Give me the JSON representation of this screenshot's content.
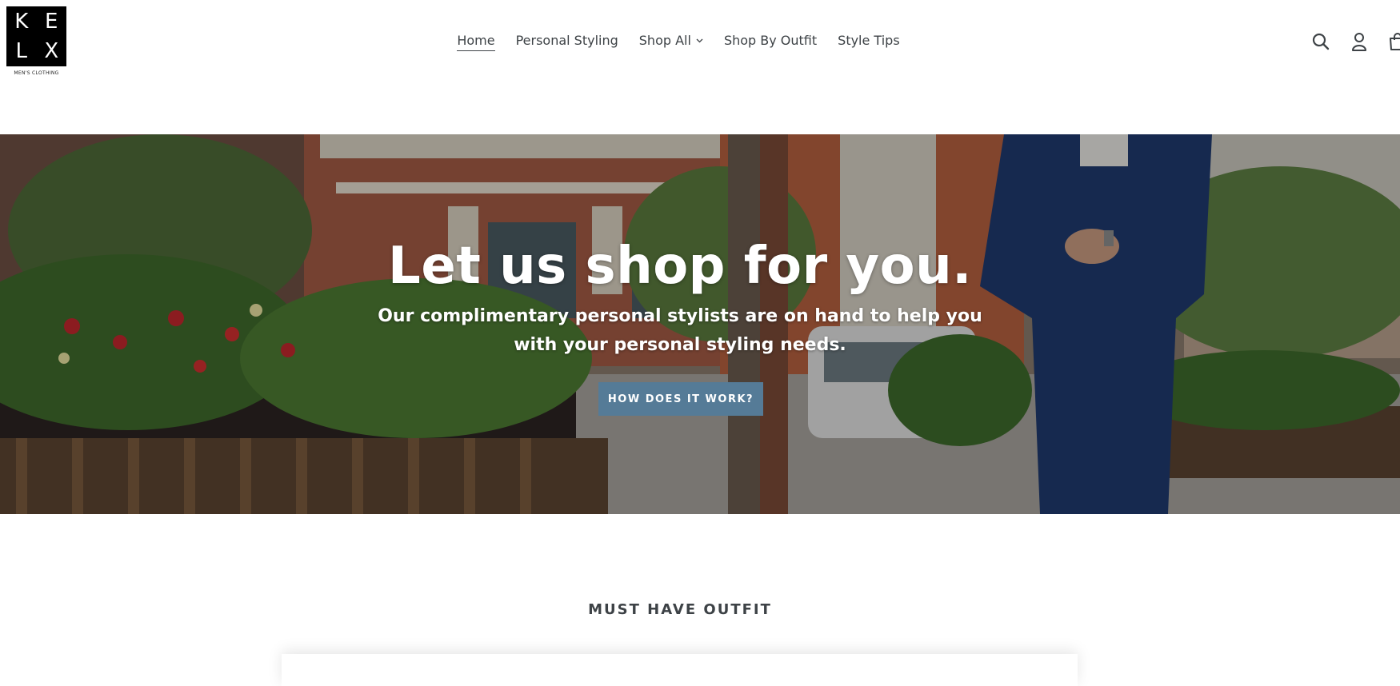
{
  "logo": {
    "letters": [
      "K",
      "E",
      "L",
      "X"
    ],
    "subtitle": "MEN'S CLOTHING"
  },
  "nav": {
    "items": [
      {
        "label": "Home",
        "active": true
      },
      {
        "label": "Personal Styling",
        "active": false
      },
      {
        "label": "Shop All",
        "active": false,
        "has_dropdown": true
      },
      {
        "label": "Shop By Outfit",
        "active": false
      },
      {
        "label": "Style Tips",
        "active": false
      }
    ]
  },
  "header_icons": [
    "search-icon",
    "account-icon",
    "cart-icon"
  ],
  "hero": {
    "title": "Let us shop for you.",
    "subtitle": "Our complimentary personal stylists are on hand to help you with your personal styling needs.",
    "button_label": "HOW DOES IT WORK?"
  },
  "section": {
    "title": "MUST HAVE OUTFIT"
  },
  "colors": {
    "button": "#557b97",
    "text": "#3d4246",
    "logo_bg": "#000000"
  }
}
